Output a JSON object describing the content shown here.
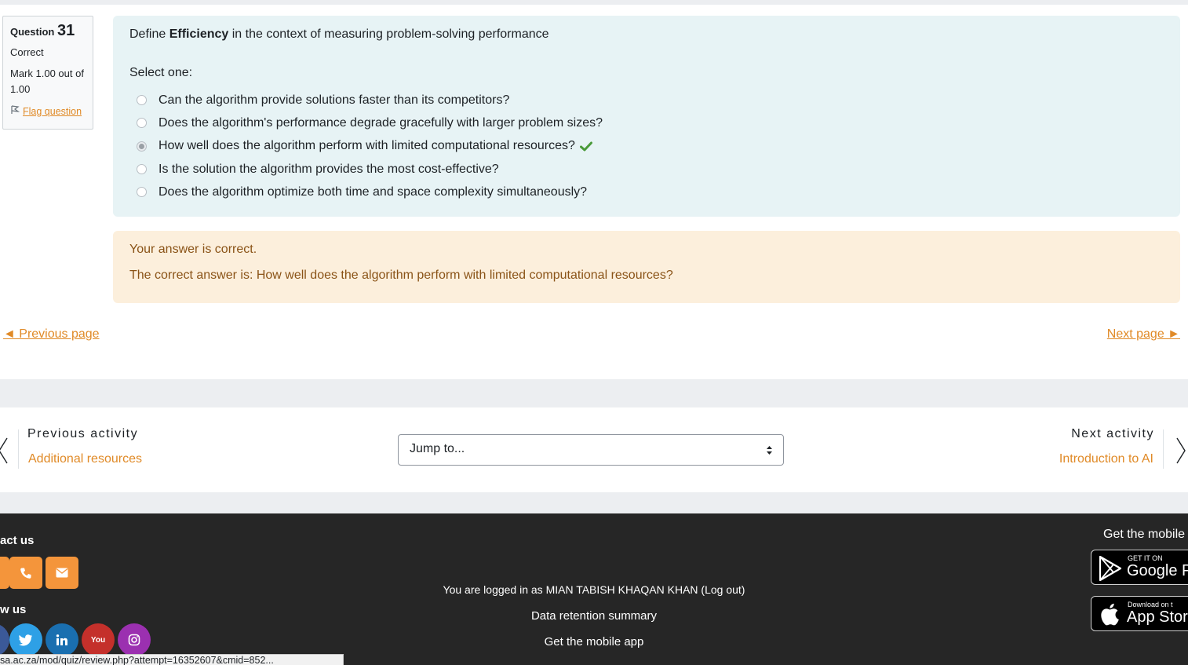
{
  "question": {
    "label": "Question",
    "number": "31",
    "state": "Correct",
    "grade": "Mark 1.00 out of 1.00",
    "flag_label": "Flag question",
    "text_prefix": "Define",
    "text_bold": "Efficiency",
    "text_suffix": "in the context of measuring problem-solving performance",
    "prompt": "Select one:",
    "options": [
      {
        "label": "Can the algorithm provide solutions faster than its competitors?",
        "checked": false
      },
      {
        "label": "Does the algorithm's performance degrade gracefully with larger problem sizes?",
        "checked": false
      },
      {
        "label": "How well does the algorithm perform with limited computational resources?",
        "checked": true
      },
      {
        "label": "Is the solution the algorithm provides the most cost-effective?",
        "checked": false
      },
      {
        "label": "Does the algorithm optimize both time and space complexity simultaneously?",
        "checked": false
      }
    ]
  },
  "feedback": {
    "status": "Your answer is correct.",
    "right_answer": "The correct answer is: How well does the algorithm perform with limited computational resources?"
  },
  "pagination": {
    "prev": "◄ Previous page",
    "next": "Next page ►"
  },
  "activity_nav": {
    "prev_label": "Previous activity",
    "prev_link": "Additional resources",
    "next_label": "Next activity",
    "next_link": "Introduction to AI",
    "jump_placeholder": "Jump to..."
  },
  "footer": {
    "contact_heading": "act us",
    "follow_heading": "w us",
    "logged_in_text": "You are logged in as MIAN TABISH KHAQAN KHAN (Log out)",
    "data_retention": "Data retention summary",
    "get_app": "Get the mobile app",
    "get_app_title": "Get the mobile",
    "google_small": "GET IT ON",
    "google_big": "Google Pla",
    "apple_small": "Download on t",
    "apple_big": "App Stor",
    "youtube_text": "You"
  },
  "status_url": "sa.ac.za/mod/quiz/review.php?attempt=16352607&cmid=852...",
  "colors": {
    "accent": "#e08a27",
    "question_bg": "#e7f3f5",
    "feedback_bg": "#fcefdc",
    "footer_bg": "#262626",
    "check_green": "#357a32"
  }
}
